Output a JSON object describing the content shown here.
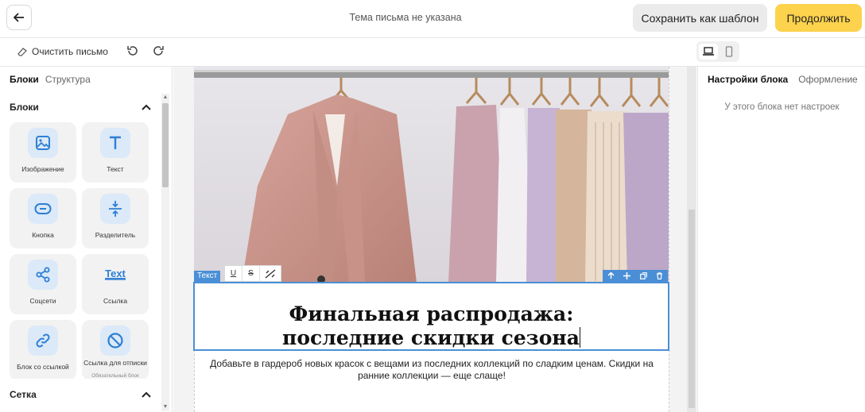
{
  "header": {
    "subject": "Тема письма не указана",
    "save_template": "Сохранить как шаблон",
    "continue": "Продолжить"
  },
  "toolbar": {
    "clear": "Очистить письмо"
  },
  "left": {
    "tabs": [
      "Блоки",
      "Структура"
    ],
    "section_blocks": "Блоки",
    "section_grid": "Сетка",
    "tiles": [
      {
        "label": "Изображение",
        "icon": "image-icon"
      },
      {
        "label": "Текст",
        "icon": "text-icon"
      },
      {
        "label": "Кнопка",
        "icon": "button-icon"
      },
      {
        "label": "Разделитель",
        "icon": "divider-icon"
      },
      {
        "label": "Соцсети",
        "icon": "share-icon"
      },
      {
        "label": "Ссылка",
        "icon": "link-text-icon"
      },
      {
        "label": "Блок со ссылкой",
        "icon": "link-icon"
      },
      {
        "label": "Ссылка для отписки",
        "sub": "Обязательный блок",
        "icon": "unsubscribe-icon"
      }
    ]
  },
  "editor": {
    "block_tag": "Текст",
    "fmt": [
      "U",
      "S"
    ],
    "heading_line1": "Финальная распродажа:",
    "heading_line2": "последние скидки сезона",
    "description": "Добавьте в гардероб новых красок с вещами из последних коллекций по сладким ценам. Скидки на ранние коллекции — еще слаще!"
  },
  "right": {
    "tabs": [
      "Настройки блока",
      "Оформление"
    ],
    "empty": "У этого блока нет настроек"
  },
  "colors": {
    "accent_yellow": "#fdd24c",
    "selection_blue": "#4a8fd6",
    "icon_blue": "#2f7fd4"
  }
}
